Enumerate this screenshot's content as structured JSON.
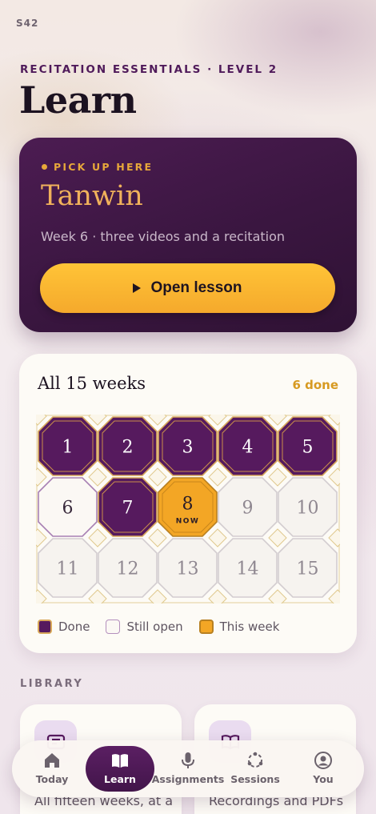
{
  "status": {
    "code": "S42"
  },
  "header": {
    "kicker": "RECITATION ESSENTIALS · LEVEL 2",
    "title": "Learn"
  },
  "hero": {
    "pickup_label": "PICK UP HERE",
    "title": "Tanwin",
    "subtitle": "Week 6 · three videos and a recitation",
    "button_label": "Open lesson"
  },
  "weeks": {
    "title": "All 15 weeks",
    "done_count": "6 done",
    "now_label": "NOW",
    "items": [
      {
        "n": "1",
        "state": "done"
      },
      {
        "n": "2",
        "state": "done"
      },
      {
        "n": "3",
        "state": "done"
      },
      {
        "n": "4",
        "state": "done"
      },
      {
        "n": "5",
        "state": "done"
      },
      {
        "n": "6",
        "state": "open"
      },
      {
        "n": "7",
        "state": "done"
      },
      {
        "n": "8",
        "state": "now"
      },
      {
        "n": "9",
        "state": "locked"
      },
      {
        "n": "10",
        "state": "locked"
      },
      {
        "n": "11",
        "state": "locked"
      },
      {
        "n": "12",
        "state": "locked"
      },
      {
        "n": "13",
        "state": "locked"
      },
      {
        "n": "14",
        "state": "locked"
      },
      {
        "n": "15",
        "state": "locked"
      }
    ],
    "legend": {
      "done": "Done",
      "open": "Still open",
      "now": "This week"
    }
  },
  "library": {
    "label": "LIBRARY",
    "cards": [
      {
        "icon": "course-icon",
        "desc": "All fifteen weeks, at a"
      },
      {
        "icon": "book-icon",
        "desc": "Recordings and PDFs"
      }
    ]
  },
  "tabs": [
    {
      "label": "Today",
      "icon": "home-icon"
    },
    {
      "label": "Learn",
      "icon": "book-icon",
      "active": true
    },
    {
      "label": "Assignments",
      "icon": "microphone-icon"
    },
    {
      "label": "Sessions",
      "icon": "sessions-icon"
    },
    {
      "label": "You",
      "icon": "profile-icon"
    }
  ],
  "colors": {
    "plum": "#561a5e",
    "gold": "#f3a625",
    "accent_text": "#d79a22"
  }
}
